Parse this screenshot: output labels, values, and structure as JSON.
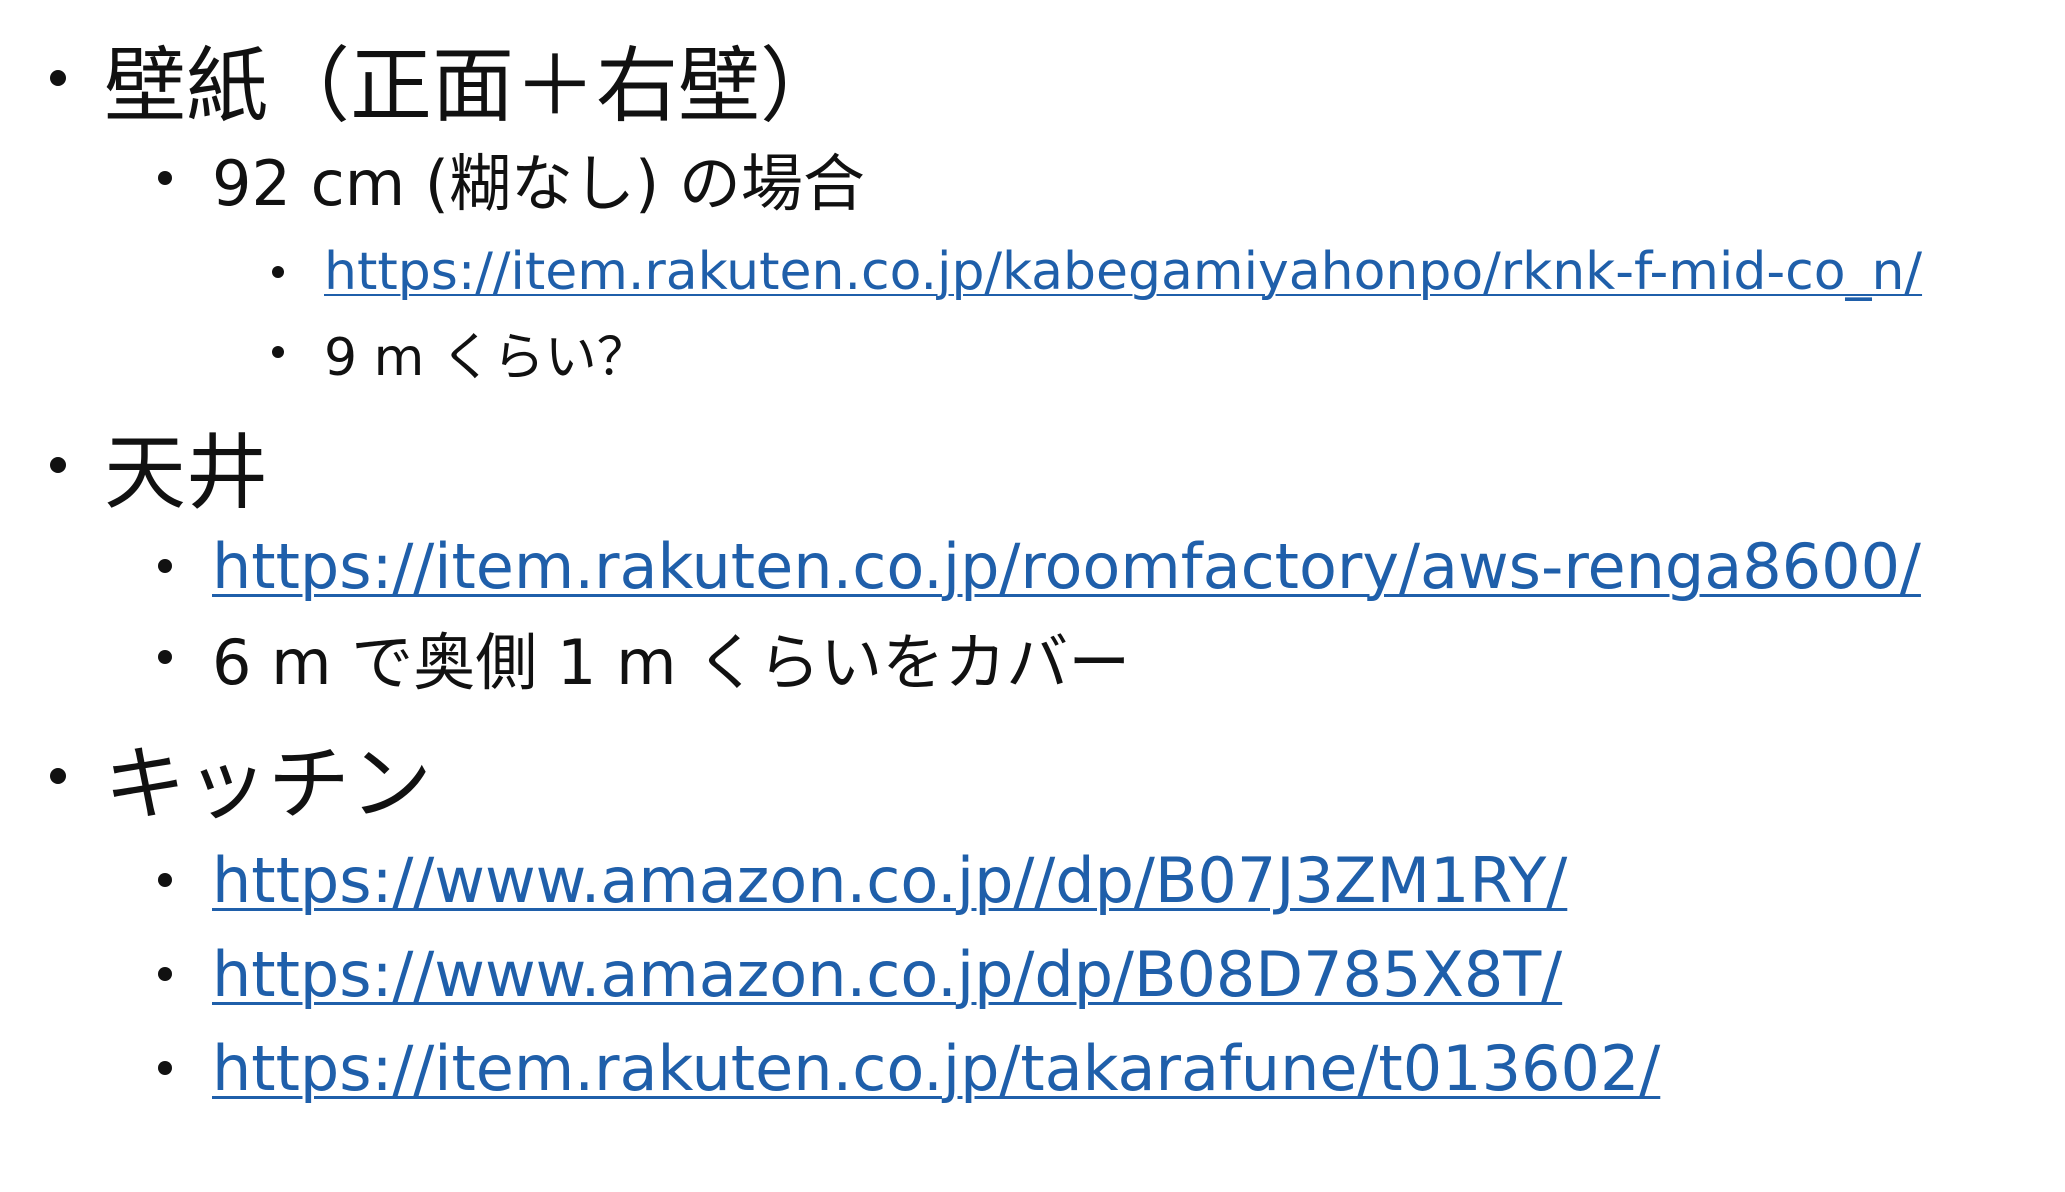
{
  "sections": [
    {
      "heading": "壁紙（正面＋右壁）",
      "sub": {
        "label": "92 cm (糊なし) の場合",
        "items": [
          {
            "text": "https://item.rakuten.co.jp/kabegamiyahonpo/rknk-f-mid-co_n/",
            "is_link": true
          },
          {
            "text": "9 m くらい？",
            "is_link": false
          }
        ]
      }
    },
    {
      "heading": "天井",
      "items": [
        {
          "text": "https://item.rakuten.co.jp/roomfactory/aws-renga8600/",
          "is_link": true
        },
        {
          "text": "6 m で奥側 1 m くらいをカバー",
          "is_link": false
        }
      ]
    },
    {
      "heading": "キッチン",
      "items": [
        {
          "text": "https://www.amazon.co.jp//dp/B07J3ZM1RY/",
          "is_link": true
        },
        {
          "text": "https://www.amazon.co.jp/dp/B08D785X8T/",
          "is_link": true
        },
        {
          "text": "https://item.rakuten.co.jp/takarafune/t013602/",
          "is_link": true
        }
      ]
    }
  ],
  "colors": {
    "text": "#111111",
    "link": "#1f5faa",
    "background": "#ffffff"
  }
}
